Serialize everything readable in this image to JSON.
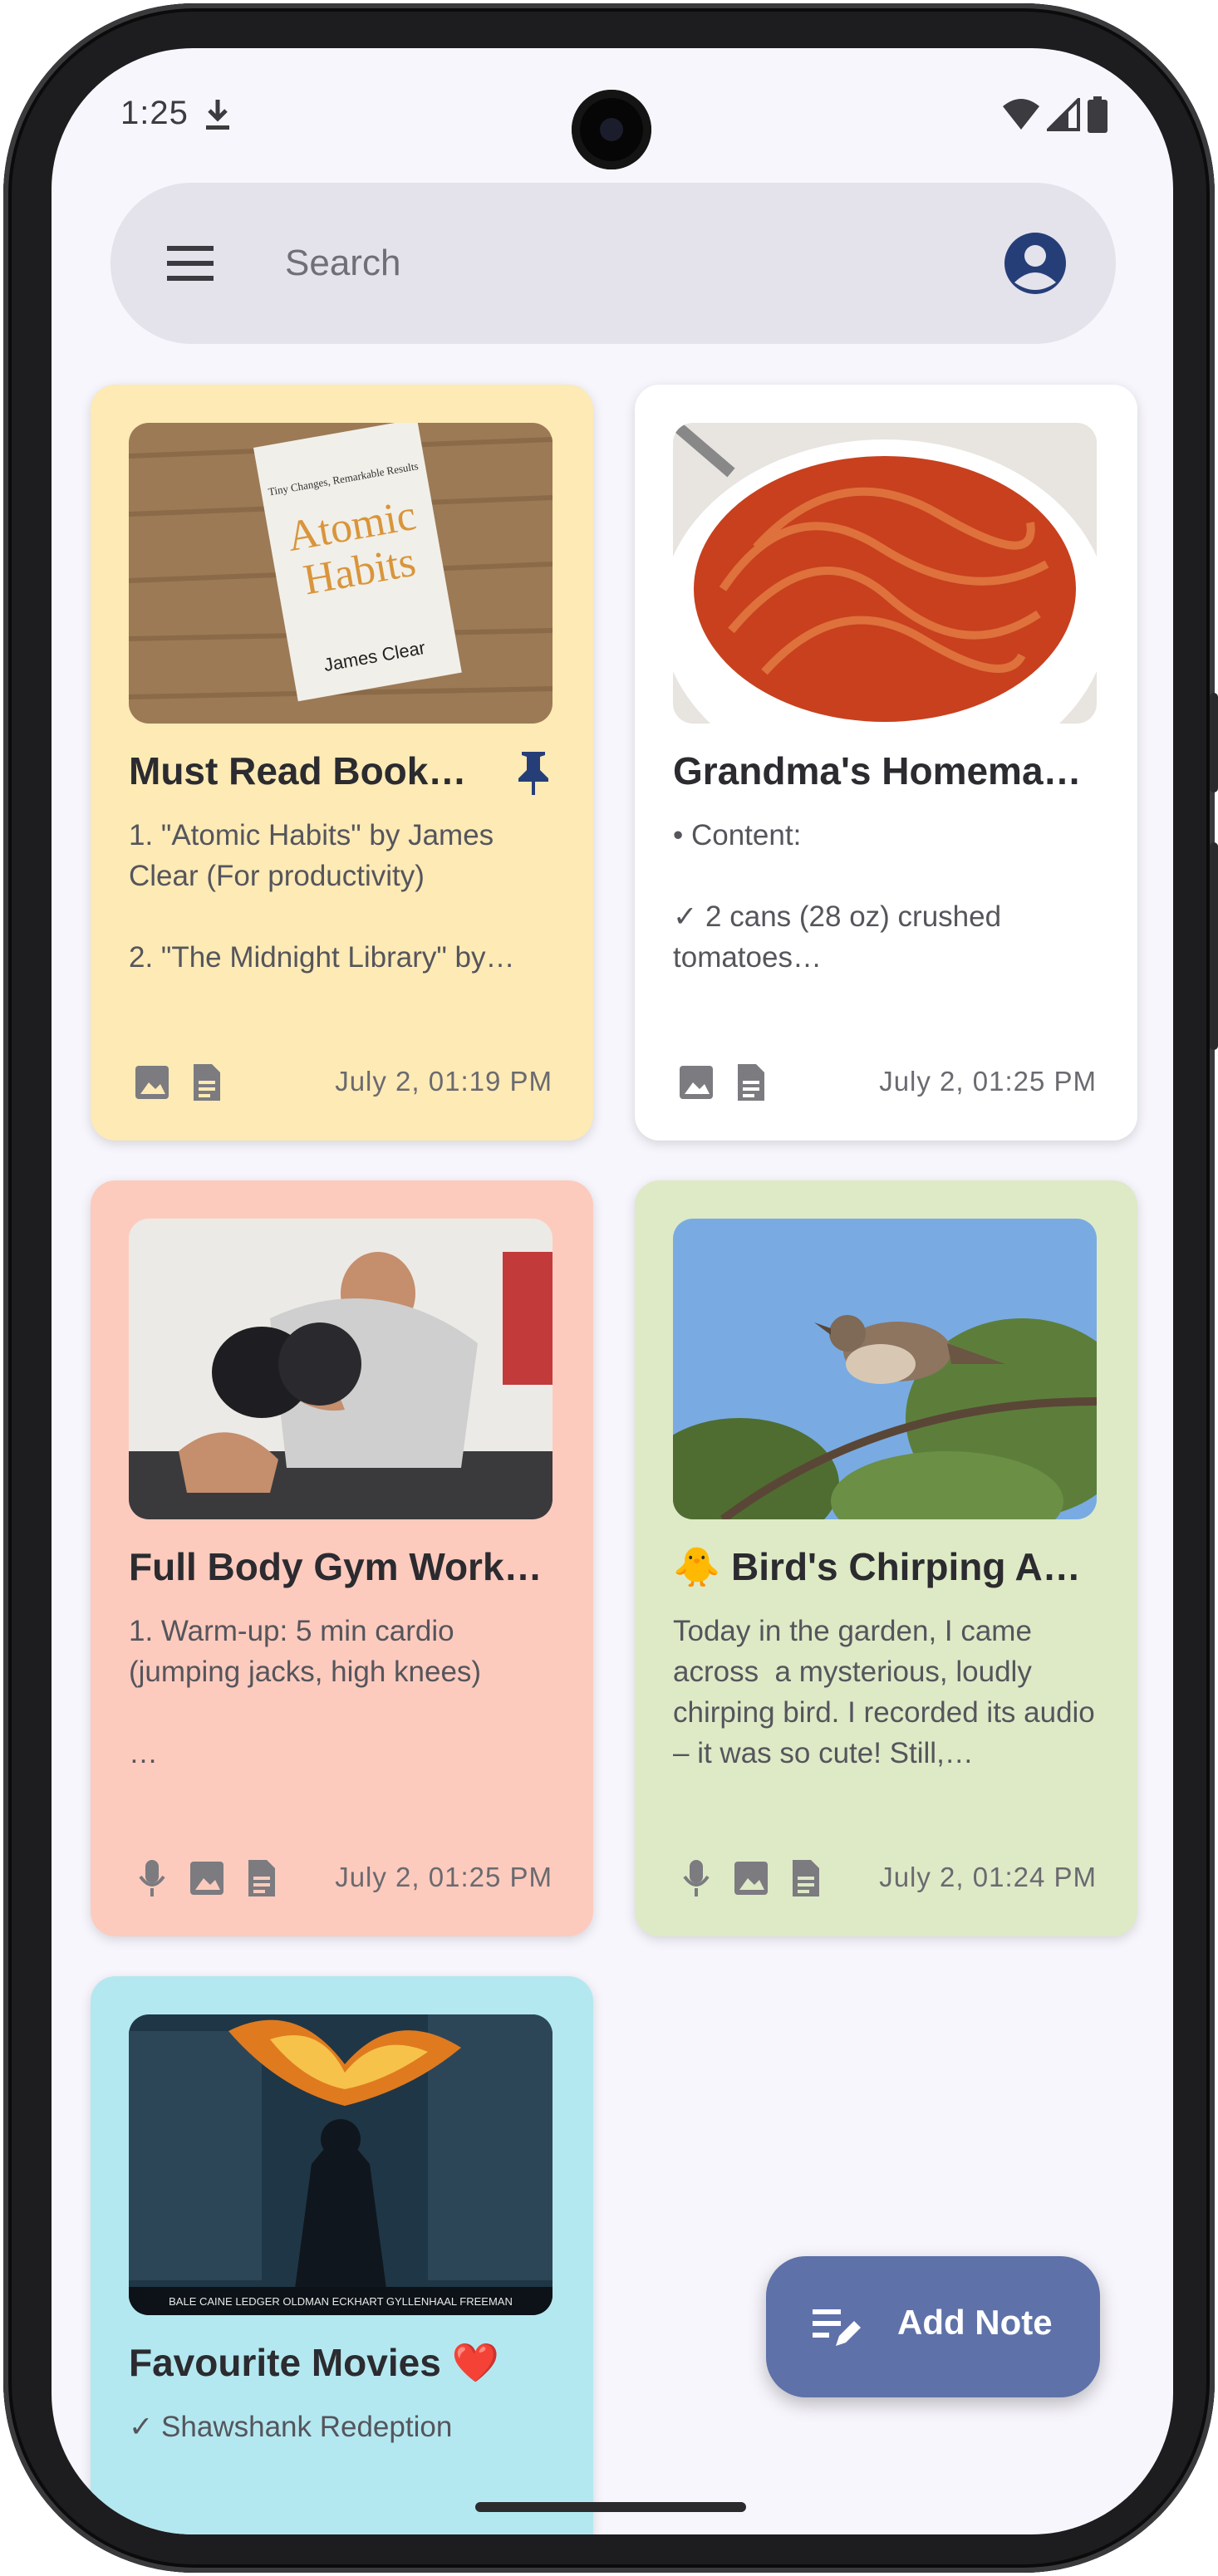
{
  "status_bar": {
    "time": "1:25"
  },
  "search": {
    "placeholder": "Search"
  },
  "notes": [
    {
      "title": "Must Read Books…",
      "body": "1. \"Atomic Habits\" by James Clear (For productivity)\n\n2. \"The Midnight Library\" by…",
      "date": "July 2, 01:19 PM",
      "pinned": true,
      "color": "#fdeab5",
      "attachments": [
        "image-icon",
        "document-icon"
      ]
    },
    {
      "title": "Grandma's Homema…",
      "body": "• Content:\n\n✓ 2 cans (28 oz) crushed tomatoes…",
      "date": "July 2, 01:25 PM",
      "pinned": false,
      "color": "#ffffff",
      "attachments": [
        "image-icon",
        "document-icon"
      ]
    },
    {
      "title": "Full Body Gym Worko…",
      "body": "1. Warm-up: 5 min cardio (jumping jacks, high knees)\n\n…",
      "date": "July 2, 01:25 PM",
      "pinned": false,
      "color": "#fdcbbd",
      "attachments": [
        "mic-icon",
        "image-icon",
        "document-icon"
      ]
    },
    {
      "title": "🐥 Bird's Chirping Au…",
      "body": "Today in the garden, I came across  a mysterious, loudly chirping bird. I recorded its audio – it was so cute! Still,…",
      "date": "July 2, 01:24 PM",
      "pinned": false,
      "color": "#deeac6",
      "attachments": [
        "mic-icon",
        "image-icon",
        "document-icon"
      ]
    },
    {
      "title": "Favourite Movies ❤️",
      "body": "✓ Shawshank Redeption",
      "date": "",
      "pinned": false,
      "color": "#b4e8f0",
      "attachments": []
    }
  ],
  "book": {
    "tagline": "Tiny Changes, Remarkable Results",
    "title_line1": "Atomic",
    "title_line2": "Habits",
    "author": "James Clear"
  },
  "movie_poster": {
    "cast": "BALE CAINE LEDGER OLDMAN ECKHART GYLLENHAAL FREEMAN"
  },
  "fab": {
    "label": "Add Note"
  },
  "colors": {
    "accent": "#5e71a9",
    "search_bg": "#e4e3ec",
    "screen_bg": "#f7f6fc"
  }
}
